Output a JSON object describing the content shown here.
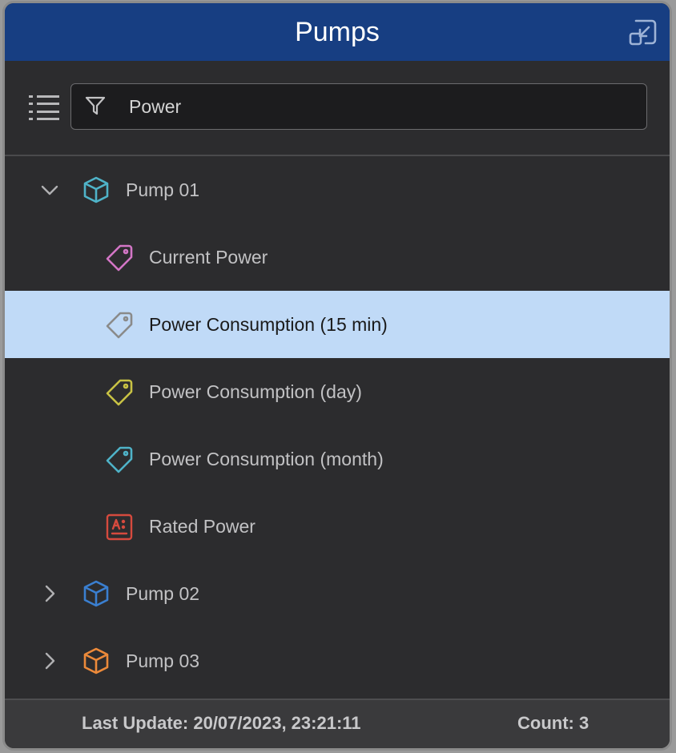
{
  "window": {
    "title": "Pumps"
  },
  "filter": {
    "value": "Power",
    "placeholder": ""
  },
  "tree": {
    "pump01": {
      "label": "Pump 01",
      "color": "#4fb3c8",
      "expanded": true
    },
    "children": [
      {
        "label": "Current Power",
        "icon": "tag-icon",
        "color": "#d376c6"
      },
      {
        "label": "Power Consumption (15 min)",
        "icon": "tag-icon",
        "color": "#8a8a8a",
        "selected": true
      },
      {
        "label": "Power Consumption (day)",
        "icon": "tag-icon",
        "color": "#c8c244"
      },
      {
        "label": "Power Consumption (month)",
        "icon": "tag-icon",
        "color": "#4fb3c8"
      },
      {
        "label": "Rated Power",
        "icon": "text-field-icon",
        "color": "#d64a3e"
      }
    ],
    "pump02": {
      "label": "Pump 02",
      "color": "#3a7fd0",
      "expanded": false
    },
    "pump03": {
      "label": "Pump 03",
      "color": "#ec8a3a",
      "expanded": false
    }
  },
  "status": {
    "last_update": "Last Update: 20/07/2023, 23:21:11",
    "count": "Count: 3"
  },
  "colors": {
    "titlebar": "#173e82",
    "panel": "#2c2c2e",
    "selection": "#c0daf7"
  }
}
